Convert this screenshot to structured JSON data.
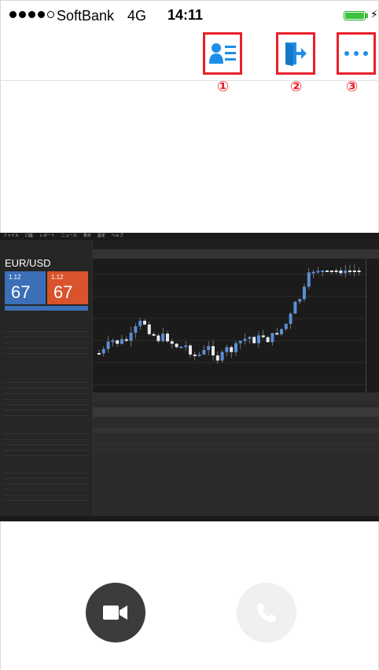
{
  "status_bar": {
    "carrier": "SoftBank",
    "network": "4G",
    "time": "14:11",
    "signal_bars": 4,
    "signal_total": 5
  },
  "toolbar": {
    "buttons": [
      {
        "icon": "participants-list-icon",
        "number": "①"
      },
      {
        "icon": "exit-icon",
        "number": "②"
      },
      {
        "icon": "more-icon",
        "number": "③"
      }
    ],
    "highlight_color": "#e8202a",
    "icon_color": "#1f8ee8"
  },
  "shared_screen": {
    "pair": "EUR/USD",
    "bid_big": "67",
    "ask_big": "67",
    "bid_small": "1.12",
    "ask_small": "1.12",
    "menu": [
      "ファイル",
      "口座",
      "レポート",
      "ニュース",
      "表示",
      "設定",
      "ヘルプ"
    ]
  },
  "call_controls": {
    "video_button_icon": "video-camera-icon",
    "phone_button_icon": "phone-icon"
  }
}
